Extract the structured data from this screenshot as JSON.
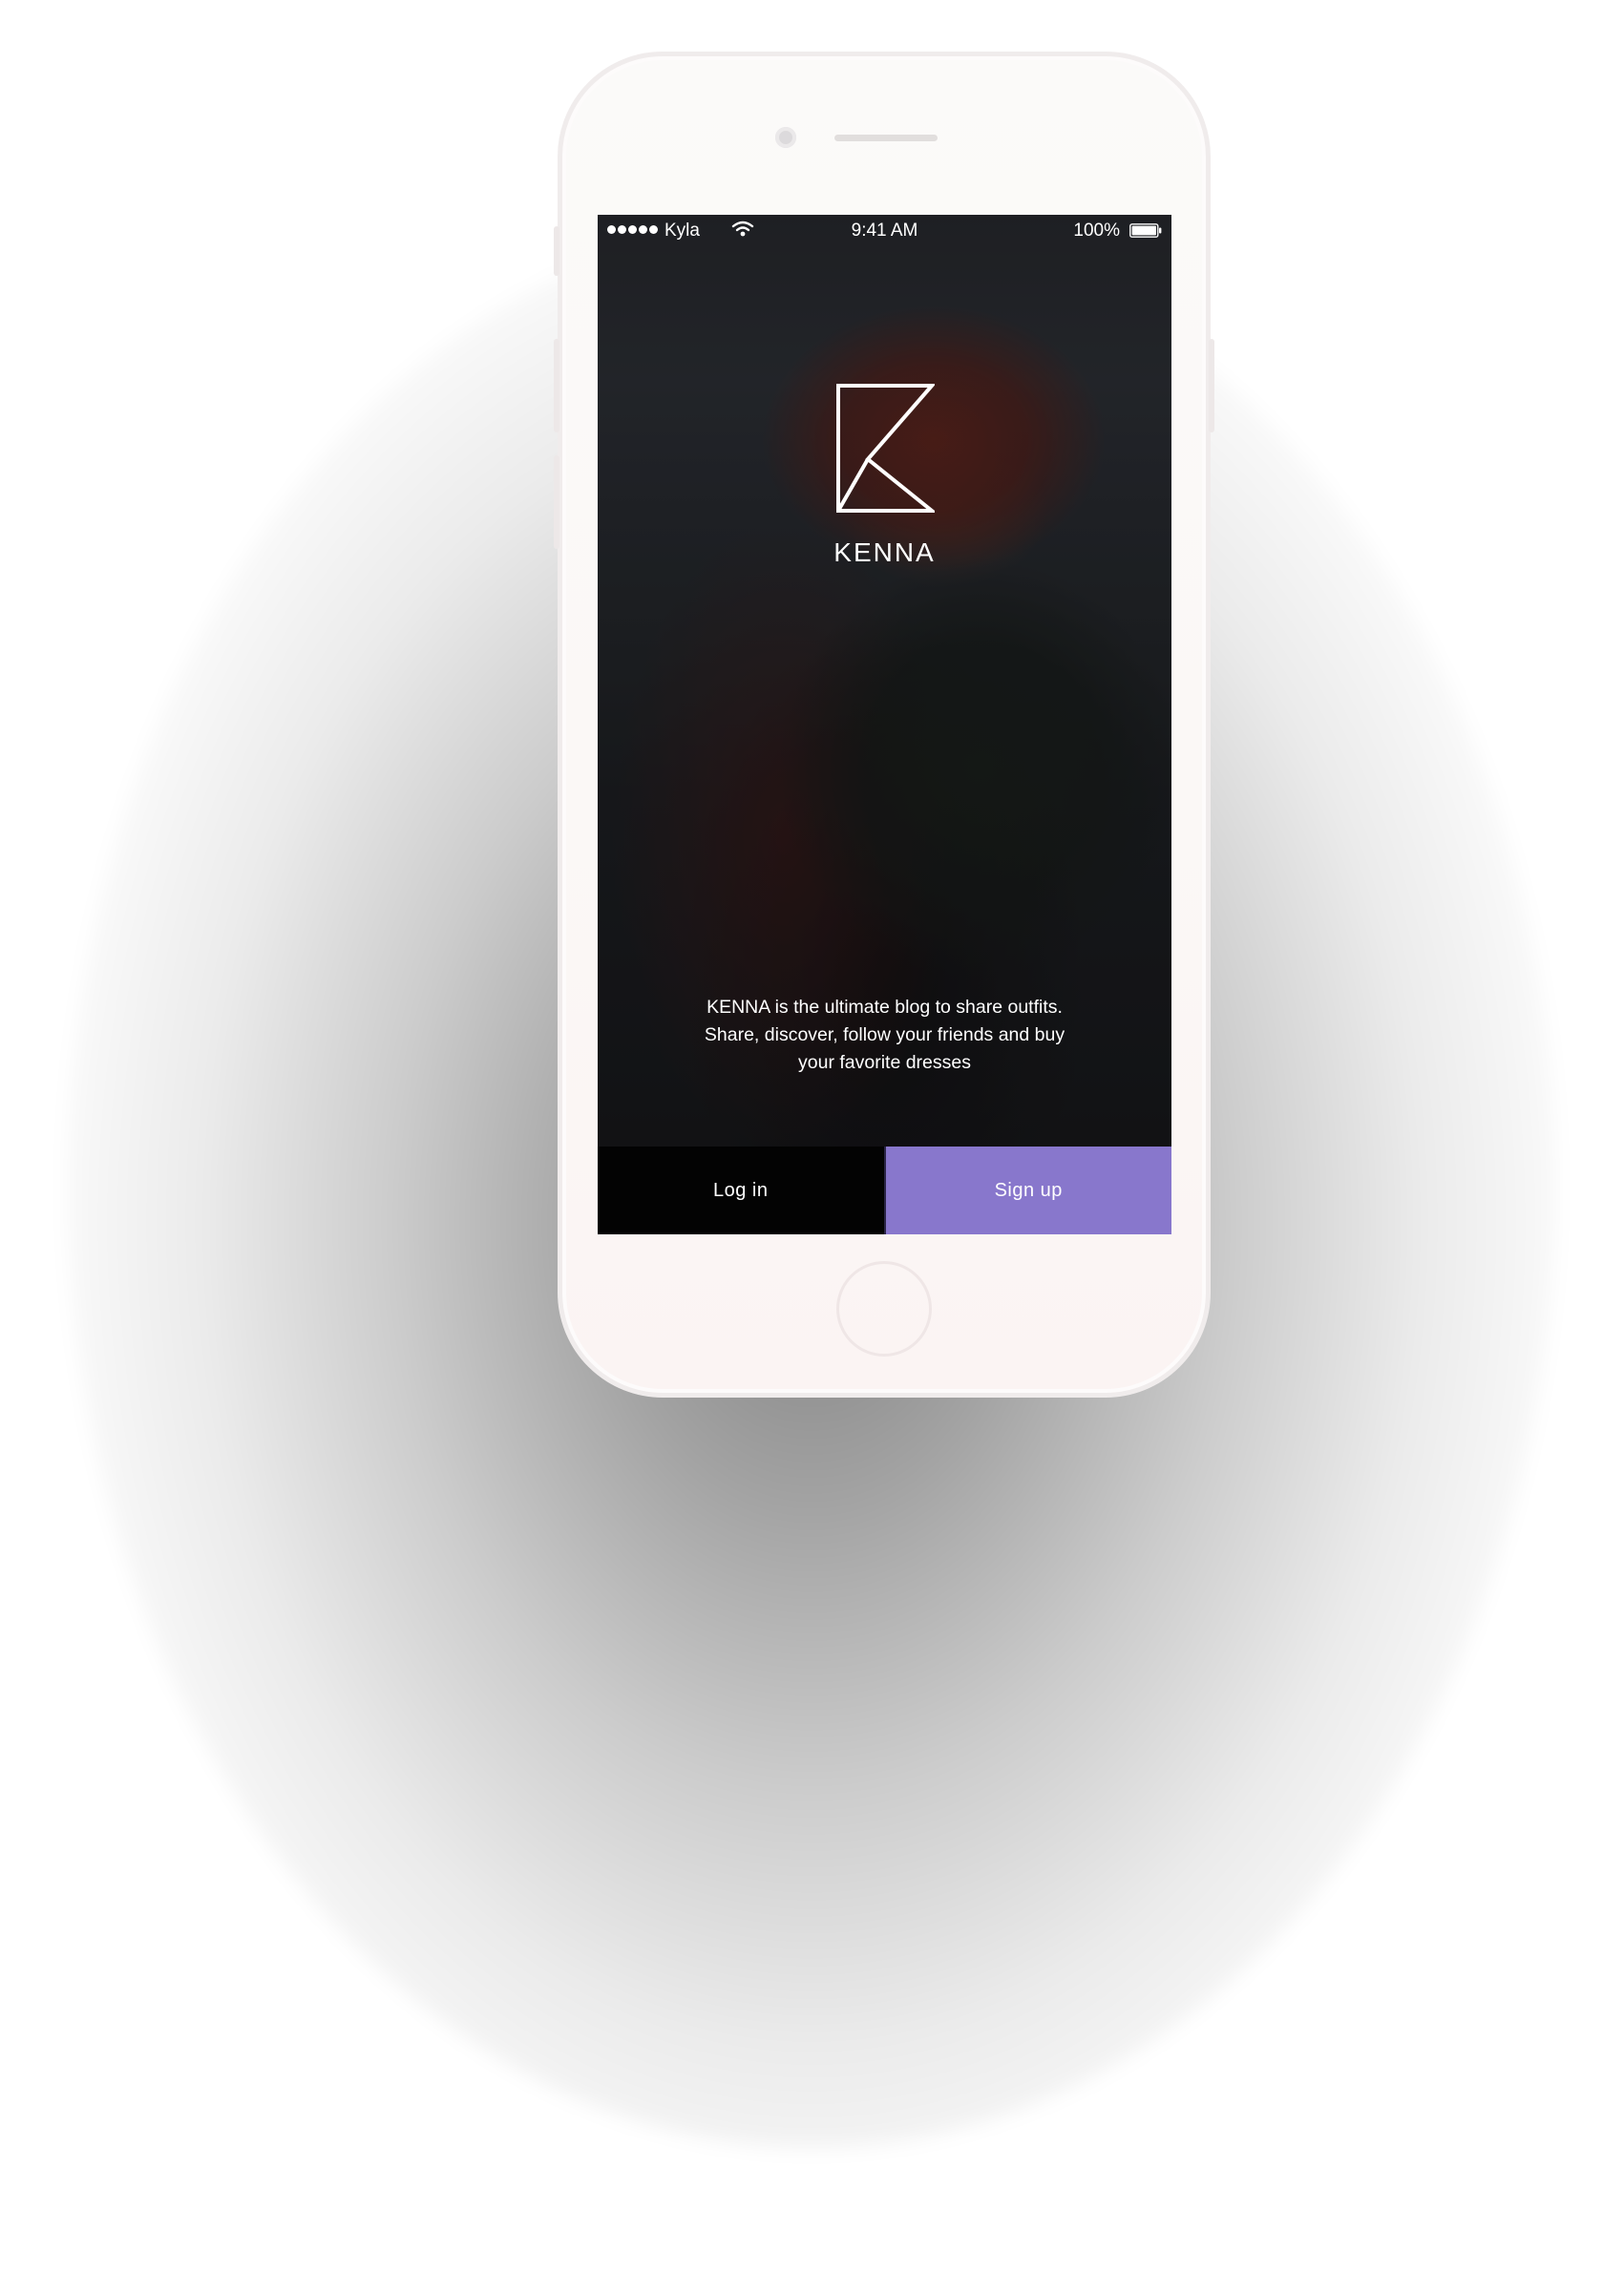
{
  "status_bar": {
    "carrier": "Kyla",
    "time": "9:41 AM",
    "battery": "100%"
  },
  "brand": {
    "name": "KENNA"
  },
  "tagline": [
    "KENNA is the ultimate blog to share outfits.",
    "Share, discover, follow your friends and buy",
    "your favorite dresses"
  ],
  "buttons": {
    "login_label": "Log in",
    "signup_label": "Sign up"
  },
  "colors": {
    "accent": "#8877cc",
    "login_background": "#030303"
  },
  "icons": {
    "signal": "signal-dots-icon",
    "wifi": "wifi-icon",
    "battery": "battery-icon",
    "logo": "kenna-k-logo"
  }
}
